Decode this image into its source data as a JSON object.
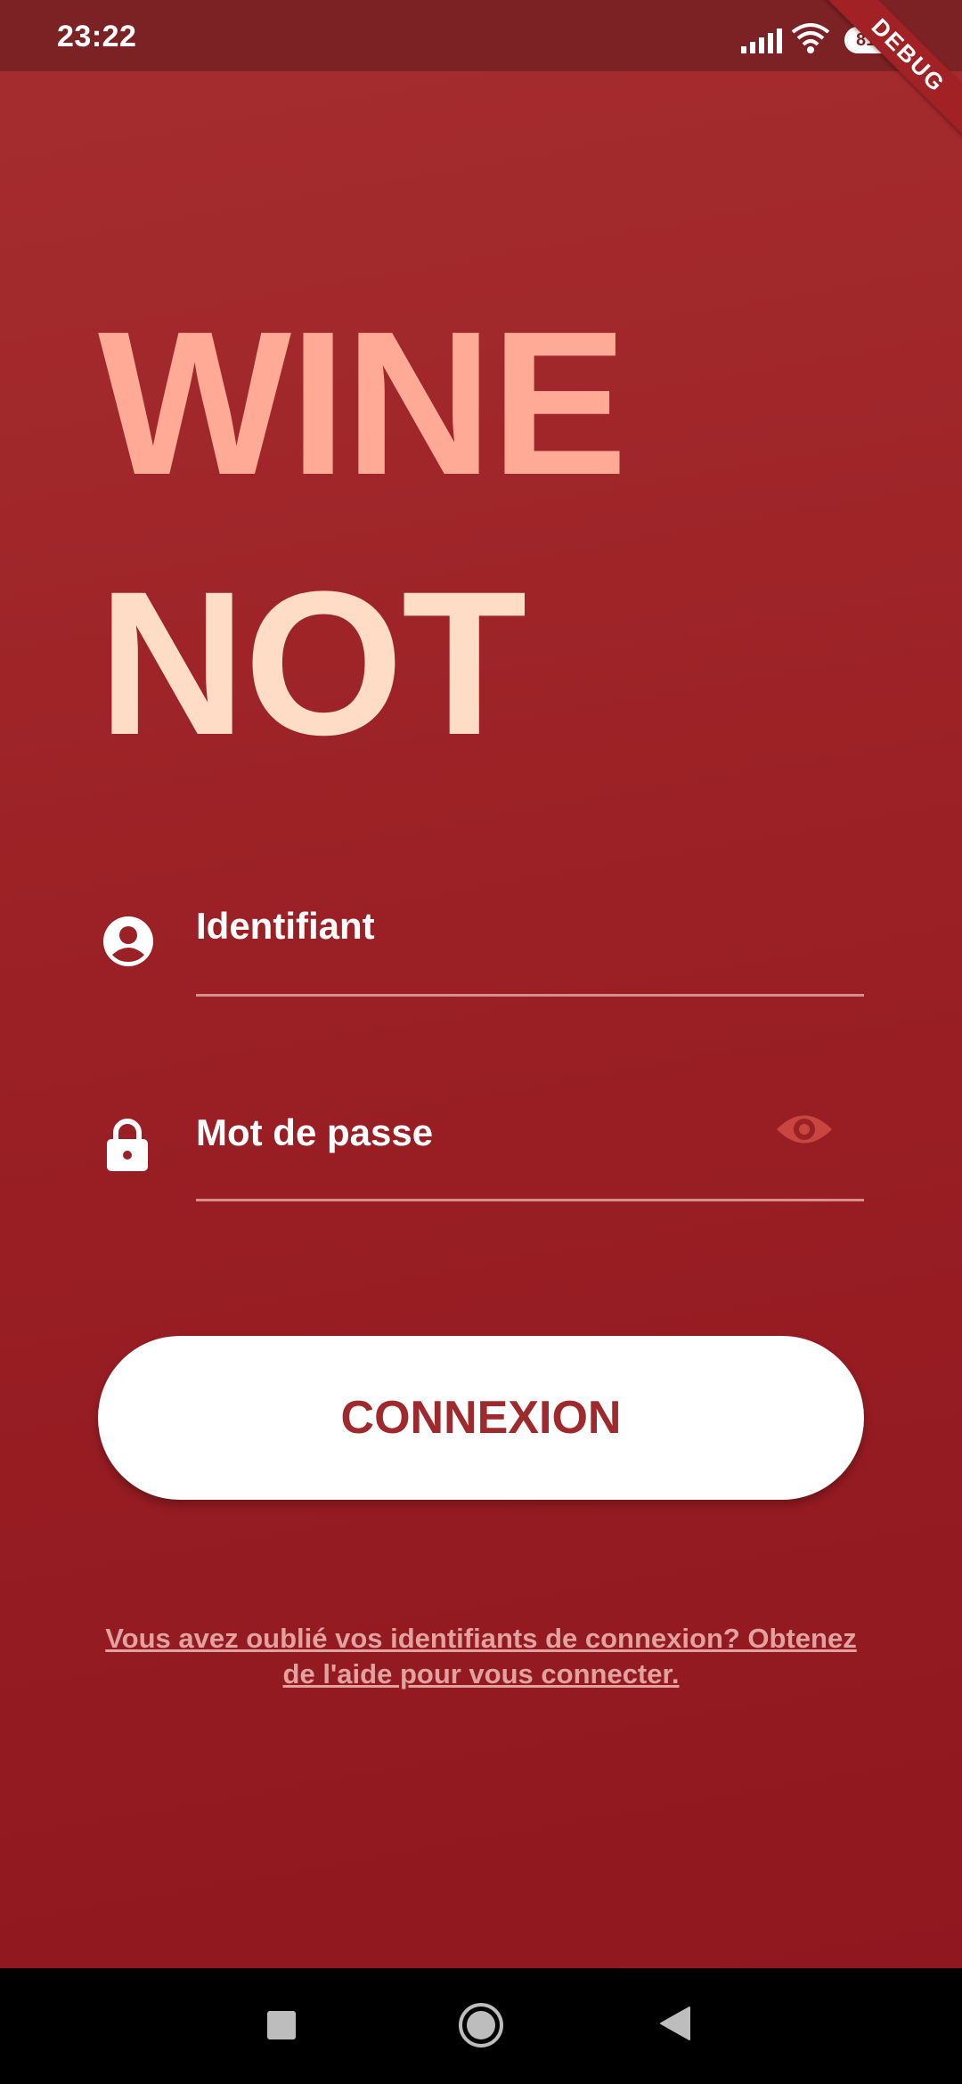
{
  "status_bar": {
    "time": "23:22",
    "battery_percent": "81",
    "battery_level": 0.81,
    "icons": [
      "signal-icon",
      "wifi-icon",
      "battery-icon"
    ]
  },
  "debug_banner": "DEBUG",
  "logo": {
    "line1": "WINE",
    "line2": "NOT",
    "line1_color": "#ffaa97",
    "line2_color": "#ffdcc6"
  },
  "form": {
    "username": {
      "placeholder": "Identifiant",
      "value": "",
      "icon": "account-circle-icon"
    },
    "password": {
      "placeholder": "Mot de passe",
      "value": "",
      "icon": "lock-icon",
      "toggle_icon": "eye-icon"
    }
  },
  "login_button": {
    "label": "CONNEXION"
  },
  "help_link": {
    "text": "Vous avez oublié vos identifiants de connexion? Obtenez de l'aide pour vous connecter."
  },
  "nav_bar": {
    "icons": [
      "recents-square-icon",
      "home-circle-icon",
      "back-triangle-icon"
    ]
  },
  "colors": {
    "background_top": "#a62d2f",
    "background_bottom": "#8f161e",
    "status_bar": "#7c2224",
    "accent": "#9e2a2e",
    "eye_icon": "#c9463f"
  }
}
